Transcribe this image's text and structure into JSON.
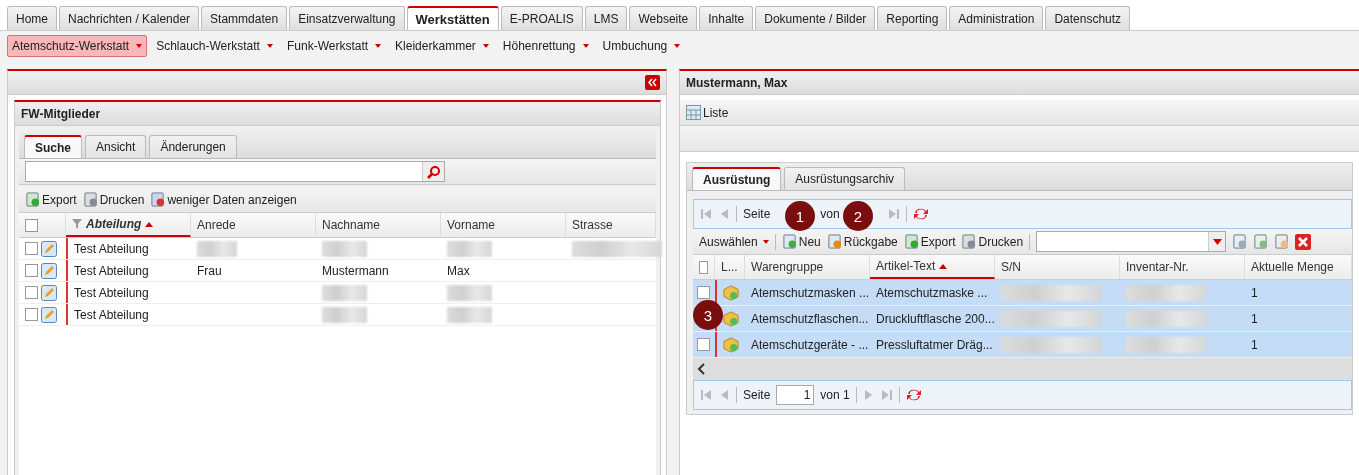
{
  "main_tabs": [
    {
      "label": "Home",
      "selected": false
    },
    {
      "label": "Nachrichten / Kalender",
      "selected": false
    },
    {
      "label": "Stammdaten",
      "selected": false
    },
    {
      "label": "Einsatzverwaltung",
      "selected": false
    },
    {
      "label": "Werkstätten",
      "selected": true
    },
    {
      "label": "E-PROALIS",
      "selected": false
    },
    {
      "label": "LMS",
      "selected": false
    },
    {
      "label": "Webseite",
      "selected": false
    },
    {
      "label": "Inhalte",
      "selected": false
    },
    {
      "label": "Dokumente / Bilder",
      "selected": false
    },
    {
      "label": "Reporting",
      "selected": false
    },
    {
      "label": "Administration",
      "selected": false
    },
    {
      "label": "Datenschutz",
      "selected": false
    }
  ],
  "sub_menu": [
    {
      "label": "Atemschutz-Werkstatt",
      "selected": true
    },
    {
      "label": "Schlauch-Werkstatt",
      "selected": false
    },
    {
      "label": "Funk-Werkstatt",
      "selected": false
    },
    {
      "label": "Kleiderkammer",
      "selected": false
    },
    {
      "label": "Höhenrettung",
      "selected": false
    },
    {
      "label": "Umbuchung",
      "selected": false
    }
  ],
  "left_panel": {
    "title": "FW-Mitglieder",
    "tabs": [
      {
        "label": "Suche",
        "selected": true
      },
      {
        "label": "Ansicht",
        "selected": false
      },
      {
        "label": "Änderungen",
        "selected": false
      }
    ],
    "toolbar": [
      "Export",
      "Drucken",
      "weniger Daten anzeigen"
    ],
    "all_checked": false,
    "columns": [
      {
        "label": "Abteilung",
        "sorted": true
      },
      {
        "label": "Anrede",
        "sorted": false
      },
      {
        "label": "Nachname",
        "sorted": false
      },
      {
        "label": "Vorname",
        "sorted": false
      },
      {
        "label": "Strasse",
        "sorted": false
      }
    ],
    "rows": [
      {
        "checked": false,
        "cells": [
          {
            "kind": "text",
            "text": "Test Abteilung"
          },
          {
            "kind": "blurred"
          },
          {
            "kind": "blurred"
          },
          {
            "kind": "blurred"
          },
          {
            "kind": "blurred"
          }
        ]
      },
      {
        "checked": false,
        "cells": [
          {
            "kind": "text",
            "text": "Test Abteilung"
          },
          {
            "kind": "text",
            "text": "Frau"
          },
          {
            "kind": "text",
            "text": "Mustermann"
          },
          {
            "kind": "text",
            "text": "Max"
          },
          {
            "kind": "empty"
          }
        ]
      },
      {
        "checked": false,
        "cells": [
          {
            "kind": "text",
            "text": "Test Abteilung"
          },
          {
            "kind": "empty"
          },
          {
            "kind": "blurred"
          },
          {
            "kind": "blurred"
          },
          {
            "kind": "empty"
          }
        ]
      },
      {
        "checked": false,
        "cells": [
          {
            "kind": "text",
            "text": "Test Abteilung"
          },
          {
            "kind": "empty"
          },
          {
            "kind": "blurred"
          },
          {
            "kind": "blurred"
          },
          {
            "kind": "empty"
          }
        ]
      }
    ]
  },
  "right_panel": {
    "title": "Mustermann, Max",
    "view_button": "Liste",
    "tabs": [
      {
        "label": "Ausrüstung",
        "selected": true
      },
      {
        "label": "Ausrüstungsarchiv",
        "selected": false
      }
    ],
    "top_pager": {
      "page_label": "Seite",
      "of_label": "von"
    },
    "toolbar": {
      "menu": "Auswählen",
      "buttons": [
        "Neu",
        "Rückgabe",
        "Export",
        "Drucken"
      ]
    },
    "all_checked": false,
    "columns": [
      {
        "label": "L...",
        "sorted": false
      },
      {
        "label": "Warengruppe",
        "sorted": false
      },
      {
        "label": "Artikel-Text",
        "sorted": true
      },
      {
        "label": "S/N",
        "sorted": false
      },
      {
        "label": "Inventar-Nr.",
        "sorted": false
      },
      {
        "label": "Aktuelle Menge",
        "sorted": false
      }
    ],
    "rows": [
      {
        "selected": true,
        "checked": false,
        "group": "Atemschutzmasken ...",
        "article": "Atemschutzmaske ...",
        "amount": "1"
      },
      {
        "selected": true,
        "group": "Atemschutzflaschen...",
        "article": "Druckluftflasche 200...",
        "amount": "1"
      },
      {
        "selected": true,
        "checked": false,
        "group": "Atemschutzgeräte - ...",
        "article": "Pressluftatmer Dräg...",
        "amount": "1"
      }
    ],
    "bottom_pager": {
      "page_label": "Seite",
      "value": "1",
      "of_label": "von 1"
    }
  },
  "callouts": [
    "1",
    "2",
    "3"
  ]
}
